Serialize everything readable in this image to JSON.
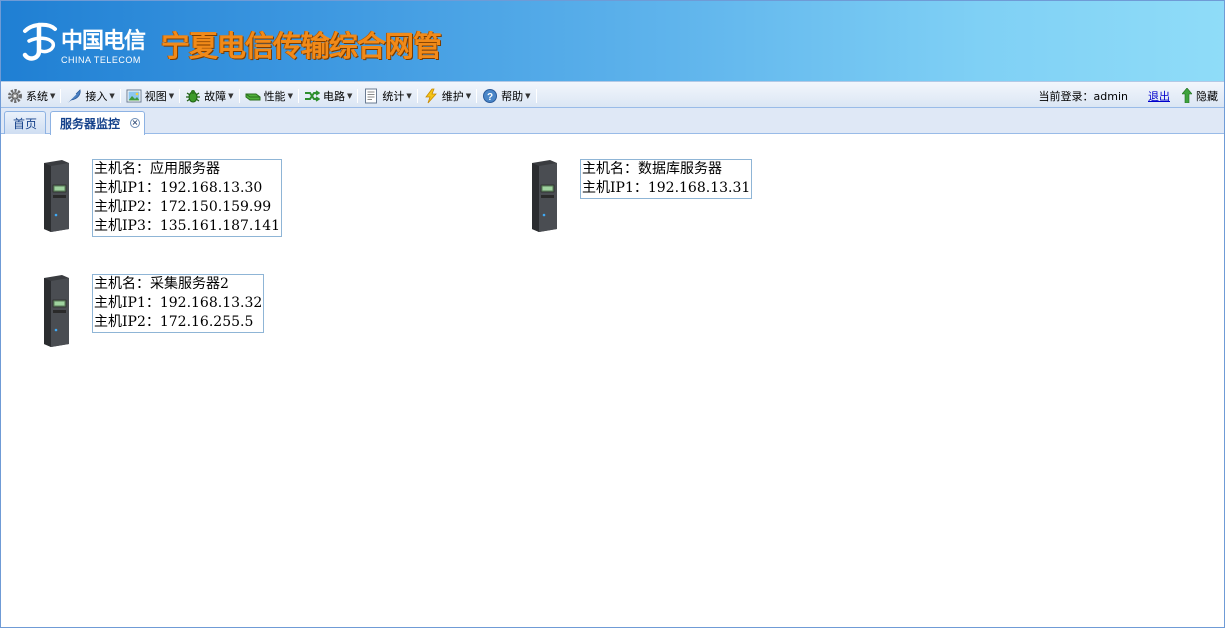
{
  "banner": {
    "logo_cn": "中国电信",
    "logo_en": "CHINA TELECOM",
    "title": "宁夏电信传输综合网管",
    "brand_color": "#f18a19"
  },
  "menu": [
    {
      "label": "系统",
      "icon": "gear-icon"
    },
    {
      "label": "接入",
      "icon": "feather-icon"
    },
    {
      "label": "视图",
      "icon": "picture-icon"
    },
    {
      "label": "故障",
      "icon": "bug-icon"
    },
    {
      "label": "性能",
      "icon": "bar-icon"
    },
    {
      "label": "电路",
      "icon": "circuit-icon"
    },
    {
      "label": "统计",
      "icon": "report-icon"
    },
    {
      "label": "维护",
      "icon": "lightning-icon"
    },
    {
      "label": "帮助",
      "icon": "help-icon"
    }
  ],
  "user": {
    "login_text": "当前登录：admin",
    "logout_label": "退出",
    "hide_label": "隐藏"
  },
  "tabs": [
    {
      "label": "首页",
      "active": false
    },
    {
      "label": "服务器监控",
      "active": true
    }
  ],
  "servers": [
    {
      "name_line": "主机名：应用服务器",
      "ips": [
        "主机IP1：192.168.13.30",
        "主机IP2：172.150.159.99",
        "主机IP3：135.161.187.141"
      ]
    },
    {
      "name_line": "主机名：数据库服务器",
      "ips": [
        "主机IP1：192.168.13.31"
      ]
    },
    {
      "name_line": "主机名：采集服务器2",
      "ips": [
        "主机IP1：192.168.13.32",
        "主机IP2：172.16.255.5"
      ]
    }
  ]
}
